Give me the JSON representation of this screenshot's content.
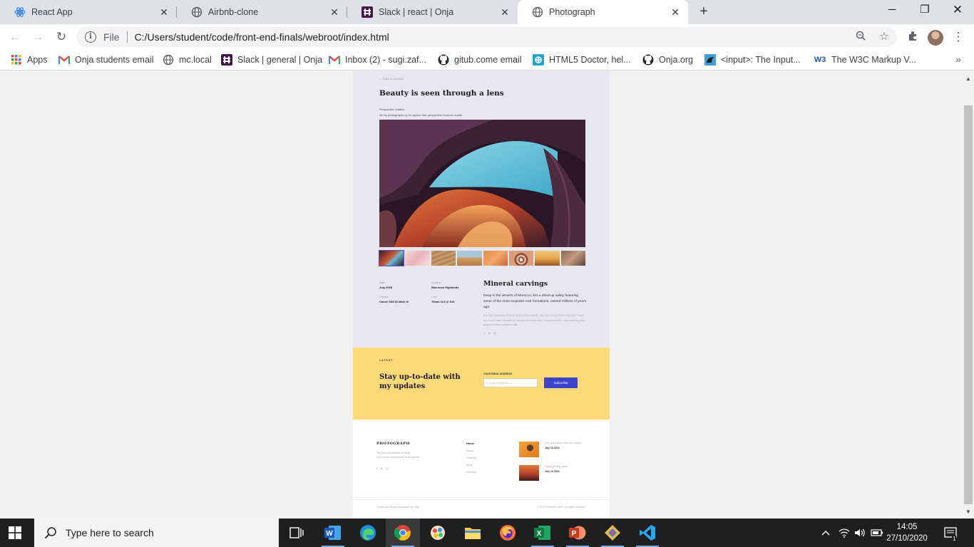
{
  "browser": {
    "tabs": [
      {
        "label": "React App",
        "icon": "react-icon"
      },
      {
        "label": "Airbnb-clone",
        "icon": "globe-icon"
      },
      {
        "label": "Slack | react | Onja",
        "icon": "slack-icon"
      },
      {
        "label": "Photograph",
        "icon": "globe-icon",
        "active": true
      }
    ],
    "address": {
      "scheme_label": "File",
      "url": "C:/Users/student/code/front-end-finals/webroot/index.html"
    },
    "bookmarks": [
      {
        "label": "Apps",
        "icon": "apps-grid-icon"
      },
      {
        "label": "Onja students email",
        "icon": "gmail-icon"
      },
      {
        "label": "mc.local",
        "icon": "globe-icon"
      },
      {
        "label": "Slack | general | Onja",
        "icon": "slack-icon"
      },
      {
        "label": "Inbox (2) - sugi.zaf...",
        "icon": "gmail-icon"
      },
      {
        "label": "gitub.come email",
        "icon": "github-icon"
      },
      {
        "label": "HTML5 Doctor, hel...",
        "icon": "html5doctor-icon"
      },
      {
        "label": "Onja.org",
        "icon": "github-icon"
      },
      {
        "label": "<input>: The Input...",
        "icon": "mdn-icon"
      },
      {
        "label": "The W3C Markup V...",
        "icon": "w3c-icon"
      }
    ]
  },
  "site": {
    "back_link": "← Back to portfolio",
    "title": "Beauty is seen through a lens",
    "intro_line1": "Perspective matters.",
    "intro_line2": "All my photographs try to capture that perspective however subtle.",
    "meta": {
      "date_label": "Date",
      "date_value": "July 2008",
      "location_label": "Location",
      "location_value": "Marrocan Highlands",
      "camera_label": "Camera",
      "camera_value": "Canon 6D5 ID Mark IV",
      "lens_label": "Lens",
      "lens_value": "70mm f1.8 @ f/16"
    },
    "detail": {
      "title": "Mineral carvings",
      "description": "Deep in the deserts of Morocco, lies a dried-up valley featuring some of the most exquisite rock formations, carved millions of years ago.",
      "note": "It is my experience of these carpets this majestic, over two to now there in person. I hope my photos have managed to capture the sheer size + grandeur even + and sparkling play nature of these sculpted walls."
    },
    "latest": {
      "kicker": "LATEST",
      "title": "Stay up-to-date with my updates",
      "email_label": "YOUR EMAIL ADDRESS",
      "email_placeholder": "e.g.name@gmail.co",
      "subscribe_label": "Subscribe"
    },
    "footer": {
      "brand": "PHOTOGRAPH",
      "description": "The personal website of Sarah McJohnson, professional photographer",
      "nav": [
        "Home",
        "About",
        "Portfolio",
        "Blog",
        "Contact"
      ],
      "posts": [
        {
          "title": "Ever-guessable skies and ripples",
          "date": "July 15 2019"
        },
        {
          "title": "Experimenting depth",
          "date": "July 15 2019"
        }
      ],
      "credit": "Created by Sarasy mecchable by Onja",
      "copyright": "© PHOTOGRAPH 2020. All rights reserved."
    }
  },
  "taskbar": {
    "search_placeholder": "Type here to search",
    "time": "14:05",
    "date": "27/10/2020",
    "notification_count": "1"
  },
  "colors": {
    "accent_blue": "#3c44c9",
    "latest_yellow": "#fdd978",
    "hero_bg": "#e7e7f0"
  }
}
